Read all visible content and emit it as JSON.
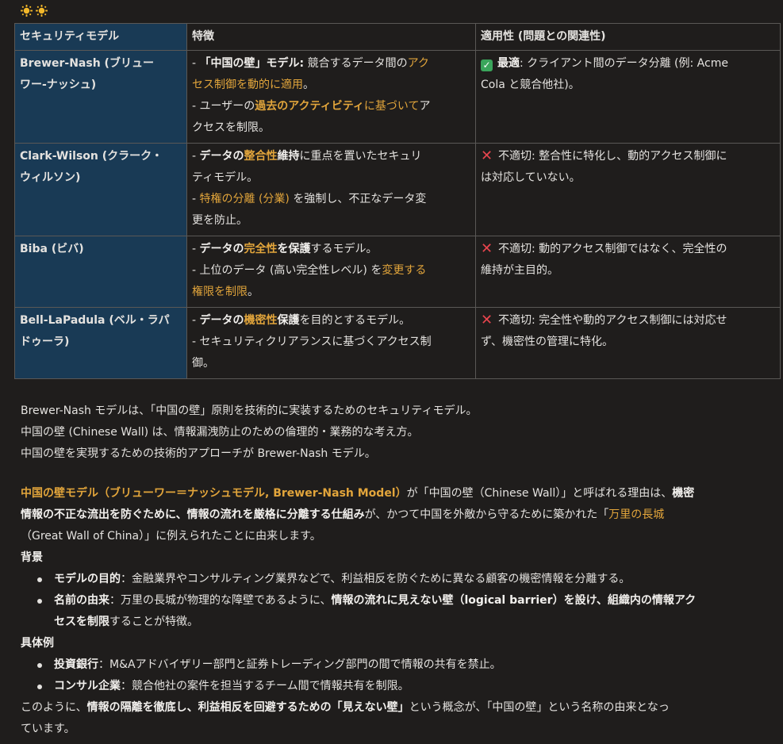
{
  "table": {
    "headers": [
      "セキュリティモデル",
      "特徴",
      "適用性 (問題との関連性)"
    ],
    "rows": [
      {
        "model": [
          "Brewer-Nash (ブリュー",
          "ワー-ナッシュ)"
        ],
        "f1_pre": "- ",
        "f1_b": "「中国の壁」モデル:",
        "f1_t": " 競合するデータ間の",
        "f1_o": "アク",
        "f1_o2": "セス制御を動的に適用",
        "f1_end": "。",
        "f2_pre": "- ユーザーの",
        "f2_ob": "過去のアクティビティ",
        "f2_o": "に基づいて",
        "f2_t": "ア",
        "f2_t2": "クセスを制限。",
        "app_b": "最適",
        "app_t": ": クライアント間のデータ分離 (例: Acme",
        "app_t2": "Cola と競合他社)。"
      },
      {
        "model": [
          "Clark-Wilson (クラーク・",
          "ウィルソン)"
        ],
        "f1_pre": "- ",
        "f1_b": "データの",
        "f1_ob": "整合性",
        "f1_b2": "維持",
        "f1_t": "に重点を置いたセキュリ",
        "f1_t2": "ティモデル。",
        "f2_pre": "- ",
        "f2_o": "特権の分離 (分業)",
        "f2_t": " を強制し、不正なデータ変",
        "f2_t2": "更を防止。",
        "app_t": "不適切: 整合性に特化し、動的アクセス制御に",
        "app_t2": "は対応していない。"
      },
      {
        "model": [
          "Biba (ビバ)"
        ],
        "f1_pre": "- ",
        "f1_b": "データの",
        "f1_ob": "完全性",
        "f1_b2": "を保護",
        "f1_t": "するモデル。",
        "f2_pre": "- 上位のデータ (高い完全性レベル) を",
        "f2_o": "変更する",
        "f2_o2": "権限を制限",
        "f2_end": "。",
        "app_t": "不適切: 動的アクセス制御ではなく、完全性の",
        "app_t2": "維持が主目的。"
      },
      {
        "model": [
          "Bell-LaPadula (ベル・ラパ",
          "ドゥーラ)"
        ],
        "f1_pre": "- ",
        "f1_b": "データの",
        "f1_ob": "機密性",
        "f1_b2": "保護",
        "f1_t": "を目的とするモデル。",
        "f2_pre": "- セキュリティクリアランスに基づくアクセス制",
        "f2_t2": "御。",
        "app_t": "不適切: 完全性や動的アクセス制御には対応せ",
        "app_t2": "ず、機密性の管理に特化。"
      }
    ]
  },
  "summary": [
    "Brewer-Nash モデルは、「中国の壁」原則を技術的に実装するためのセキュリティモデル。",
    "中国の壁 (Chinese Wall) は、情報漏洩防止のための倫理的・業務的な考え方。",
    "中国の壁を実現するための技術的アプローチが Brewer-Nash モデル。"
  ],
  "explain": {
    "l1_o": "中国の壁モデル（ブリューワー＝ナッシュモデル, Brewer-Nash Model）",
    "l1_t": "が「中国の壁（Chinese Wall）」と呼ばれる理由は、",
    "l1_b": "機密",
    "l2_b": "情報の不正な流出を防ぐために、情報の流れを厳格に分離する仕組み",
    "l2_t": "が、かつて中国を外敵から守るために築かれた「",
    "l2_o": "万里の長城",
    "l3_t": "（Great Wall of China）」に例えられたことに由来します。",
    "bg_title": "背景",
    "bg1_b": "モデルの目的",
    "bg1_t": "：金融業界やコンサルティング業界などで、利益相反を防ぐために異なる顧客の機密情報を分離する。",
    "bg2_b": "名前の由来",
    "bg2_t": "：万里の長城が物理的な障壁であるように、",
    "bg2_b2": "情報の流れに見えない壁（logical barrier）を設け、組織内の情報アク",
    "bg2_b3": "セスを制限",
    "bg2_t2": "することが特徴。",
    "ex_title": "具体例",
    "ex1_b": "投資銀行",
    "ex1_t": "：M&Aアドバイザリー部門と証券トレーディング部門の間で情報の共有を禁止。",
    "ex2_b": "コンサル企業",
    "ex2_t": "：競合他社の案件を担当するチーム間で情報共有を制限。",
    "c1_t": "このように、",
    "c1_b": "情報の隔離を徹底し、利益相反を回避するための「見えない壁」",
    "c1_t2": "という概念が、「中国の壁」という名称の由来となっ",
    "c2_t": "ています。"
  }
}
